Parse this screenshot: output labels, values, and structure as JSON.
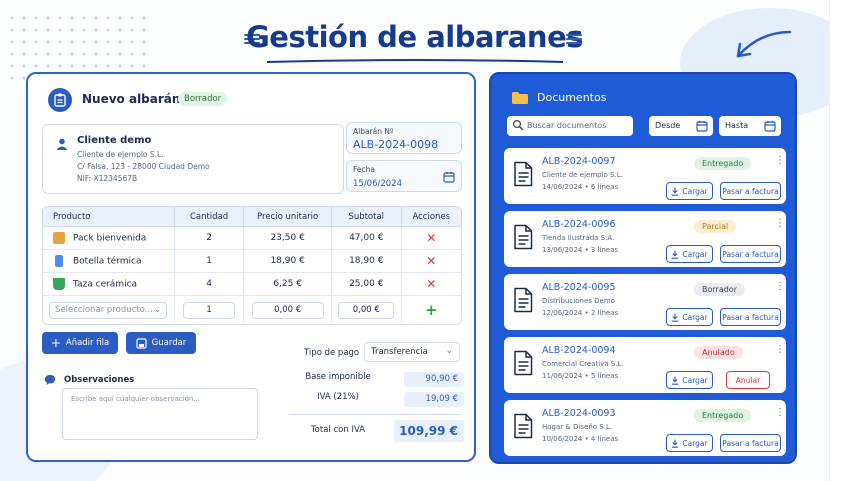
{
  "page": {
    "title": "Gestión de albaranes"
  },
  "albaran": {
    "header_title": "Nuevo albarán",
    "status_badge": "Borrador",
    "client": {
      "name": "Cliente demo",
      "lines": [
        "Cliente de ejemplo S.L.",
        "C/ Falsa, 123 - 28000 Ciudad Demo",
        "NIF: X1234567B"
      ]
    },
    "number_label": "Albarán Nº",
    "number_value": "ALB-2024-0098",
    "date_label": "Fecha",
    "date_value": "15/06/2024",
    "table": {
      "headers": [
        "Producto",
        "Cantidad",
        "Precio unitario",
        "Subtotal",
        "Acciones"
      ],
      "rows": [
        {
          "product": "Pack bienvenida",
          "qty": "2",
          "price": "23,50 €",
          "subtotal": "47,00 €",
          "icon": "box-icon",
          "color": "#e8a341"
        },
        {
          "product": "Botella térmica",
          "qty": "1",
          "price": "18,90 €",
          "subtotal": "18,90 €",
          "icon": "bottle-icon",
          "color": "#4a8ef0"
        },
        {
          "product": "Taza cerámica",
          "qty": "4",
          "price": "6,25 €",
          "subtotal": "25,00 €",
          "icon": "mug-icon",
          "color": "#38a55a"
        }
      ],
      "new_row": {
        "product_placeholder": "Seleccionar producto...",
        "qty": "1",
        "price": "0,00 €",
        "subtotal": "0,00 €"
      },
      "delete_symbol": "✕",
      "add_symbol": "+"
    },
    "buttons": {
      "add_row": "Añadir fila",
      "save": "Guardar"
    },
    "payment_label": "Tipo de pago",
    "payment_value": "Transferencia",
    "observations_label": "Observaciones",
    "observations_placeholder": "Escribe aquí cualquier observación...",
    "totals": {
      "base_label": "Base imponible",
      "base_value": "90,90 €",
      "iva_label": "IVA (21%)",
      "iva_value": "19,09 €",
      "total_label": "Total con IVA",
      "total_value": "109,99 €"
    }
  },
  "documents": {
    "title": "Documentos",
    "search_placeholder": "Buscar documentos",
    "from_label": "Desde",
    "to_label": "Hasta",
    "load_label": "Cargar",
    "items": [
      {
        "number": "ALB-2024-0097",
        "client": "Cliente de ejemplo S.L.",
        "meta": "14/06/2024 • 6 líneas",
        "status": "Entregado",
        "status_bg": "#dff3e3",
        "status_fg": "#2b7a3d",
        "action": "Pasar a factura",
        "action_style": "blue"
      },
      {
        "number": "ALB-2024-0096",
        "client": "Tienda Ilustrada S.A.",
        "meta": "13/06/2024 • 3 líneas",
        "status": "Parcial",
        "status_bg": "#fdeed2",
        "status_fg": "#b7791f",
        "action": "Pasar a factura",
        "action_style": "blue"
      },
      {
        "number": "ALB-2024-0095",
        "client": "Distribuciones Demo",
        "meta": "12/06/2024 • 2 líneas",
        "status": "Borrador",
        "status_bg": "#e9ecf1",
        "status_fg": "#3a4560",
        "action": "Pasar a factura",
        "action_style": "blue"
      },
      {
        "number": "ALB-2024-0094",
        "client": "Comercial Creativa S.L.",
        "meta": "11/06/2024 • 5 líneas",
        "status": "Anulado",
        "status_bg": "#fde3e3",
        "status_fg": "#c53030",
        "action": "Anular",
        "action_style": "red"
      },
      {
        "number": "ALB-2024-0093",
        "client": "Hogar & Diseño S.L.",
        "meta": "10/06/2024 • 4 líneas",
        "status": "Entregado",
        "status_bg": "#dff3e3",
        "status_fg": "#2b7a3d",
        "action": "Pasar a factura",
        "action_style": "blue"
      }
    ]
  }
}
